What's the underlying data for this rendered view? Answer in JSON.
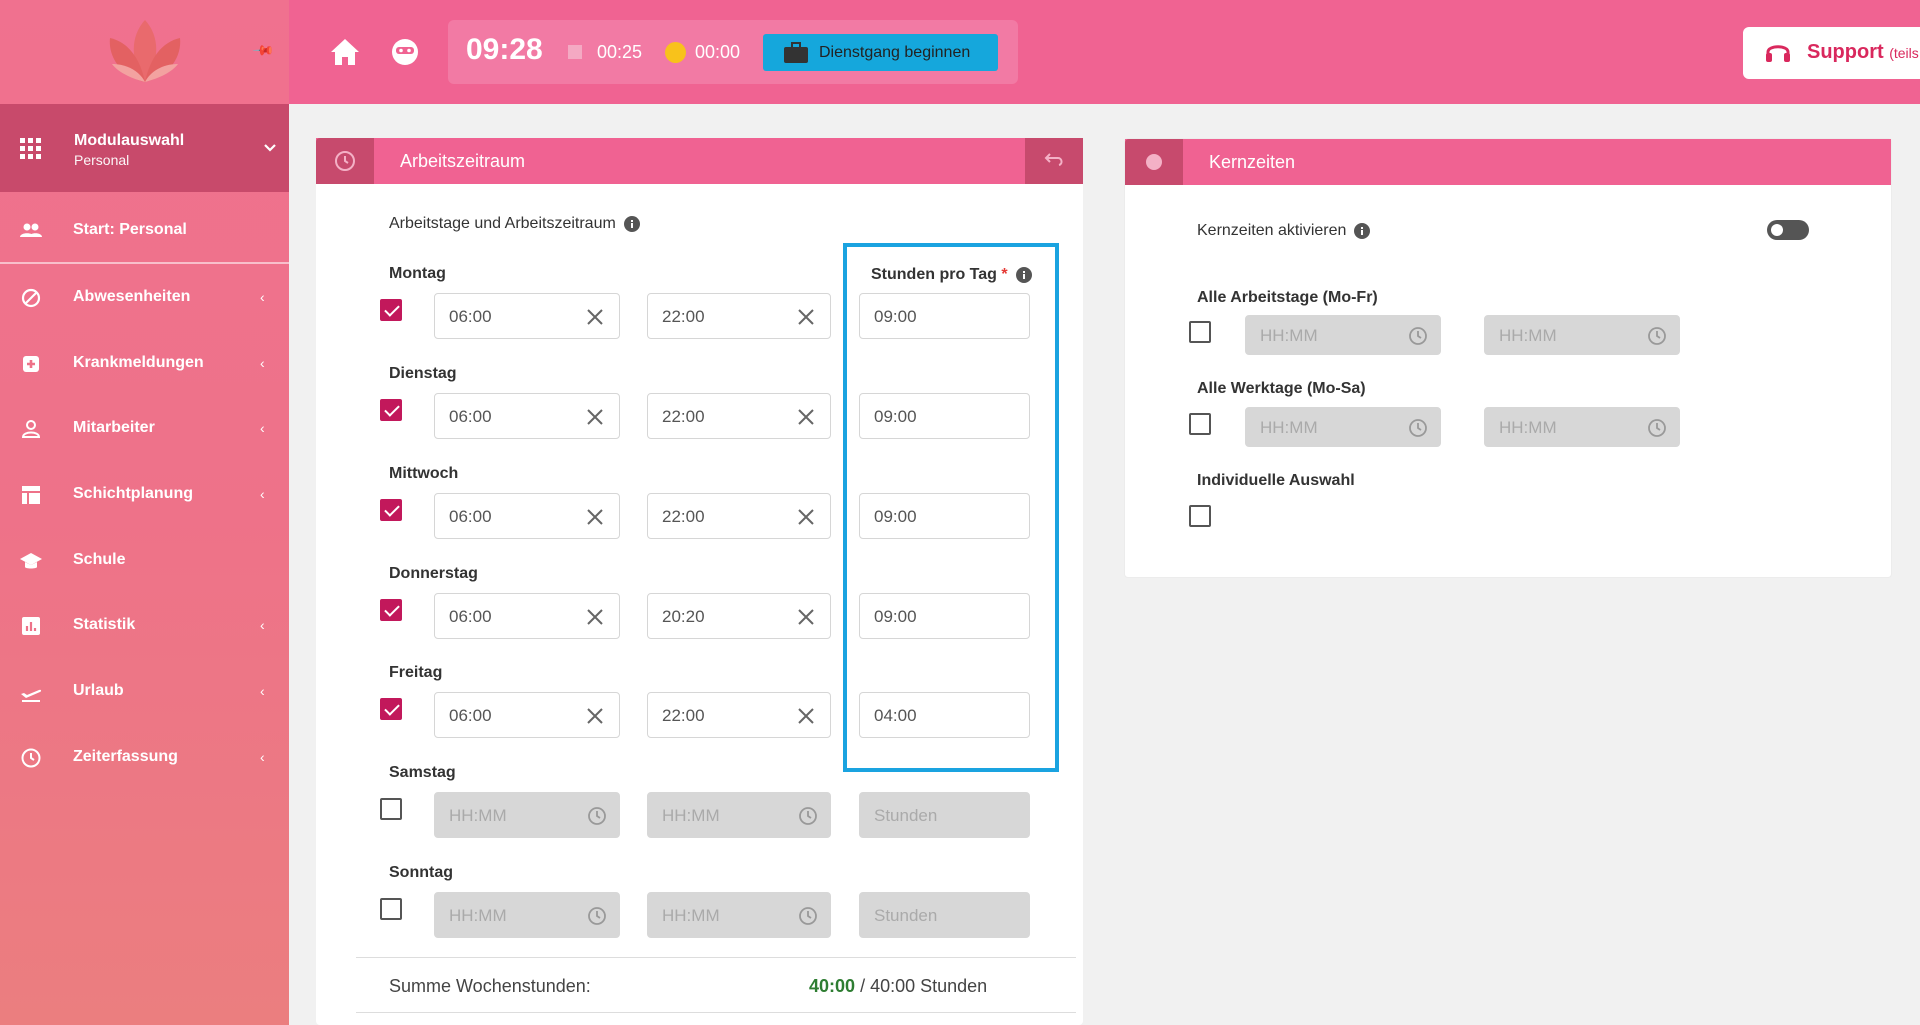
{
  "sidebar": {
    "modul_title": "Modulauswahl",
    "modul_sub": "Personal",
    "items": [
      {
        "label": "Start: Personal",
        "icon": "people-icon",
        "arrow": false
      },
      {
        "label": "Abwesenheiten",
        "icon": "block-icon",
        "arrow": true
      },
      {
        "label": "Krankmeldungen",
        "icon": "medical-icon",
        "arrow": true
      },
      {
        "label": "Mitarbeiter",
        "icon": "person-icon",
        "arrow": true
      },
      {
        "label": "Schichtplanung",
        "icon": "table-icon",
        "arrow": true
      },
      {
        "label": "Schule",
        "icon": "school-icon",
        "arrow": false
      },
      {
        "label": "Statistik",
        "icon": "chart-icon",
        "arrow": true
      },
      {
        "label": "Urlaub",
        "icon": "plane-icon",
        "arrow": true
      },
      {
        "label": "Zeiterfassung",
        "icon": "clock-icon",
        "arrow": true
      }
    ]
  },
  "header": {
    "time": "09:28",
    "pause_time": "00:25",
    "coin_time": "00:00",
    "dienstgang_label": "Dienstgang beginnen",
    "support_label": "Support",
    "support_sub": "(teils"
  },
  "arbeitszeitraum": {
    "title": "Arbeitszeitraum",
    "section_label": "Arbeitstage und Arbeitszeitraum",
    "hours_label": "Stunden pro Tag",
    "required_mark": "*",
    "days": [
      {
        "name": "Montag",
        "checked": true,
        "from": "06:00",
        "to": "22:00",
        "hours": "09:00"
      },
      {
        "name": "Dienstag",
        "checked": true,
        "from": "06:00",
        "to": "22:00",
        "hours": "09:00"
      },
      {
        "name": "Mittwoch",
        "checked": true,
        "from": "06:00",
        "to": "22:00",
        "hours": "09:00"
      },
      {
        "name": "Donnerstag",
        "checked": true,
        "from": "06:00",
        "to": "20:20",
        "hours": "09:00"
      },
      {
        "name": "Freitag",
        "checked": true,
        "from": "06:00",
        "to": "22:00",
        "hours": "04:00"
      },
      {
        "name": "Samstag",
        "checked": false,
        "from": "HH:MM",
        "to": "HH:MM",
        "hours": "Stunden"
      },
      {
        "name": "Sonntag",
        "checked": false,
        "from": "HH:MM",
        "to": "HH:MM",
        "hours": "Stunden"
      }
    ],
    "sum_label": "Summe Wochenstunden:",
    "sum_value": "40:00",
    "sum_rest": "/ 40:00 Stunden"
  },
  "kernzeiten": {
    "title": "Kernzeiten",
    "activate_label": "Kernzeiten aktivieren",
    "groups": [
      {
        "label": "Alle Arbeitstage (Mo-Fr)",
        "from": "HH:MM",
        "to": "HH:MM"
      },
      {
        "label": "Alle Werktage (Mo-Sa)",
        "from": "HH:MM",
        "to": "HH:MM"
      }
    ],
    "individual_label": "Individuelle Auswahl"
  },
  "colors": {
    "accent": "#f06292",
    "dark_accent": "#c74a6d",
    "highlight": "#1aa3e0"
  }
}
